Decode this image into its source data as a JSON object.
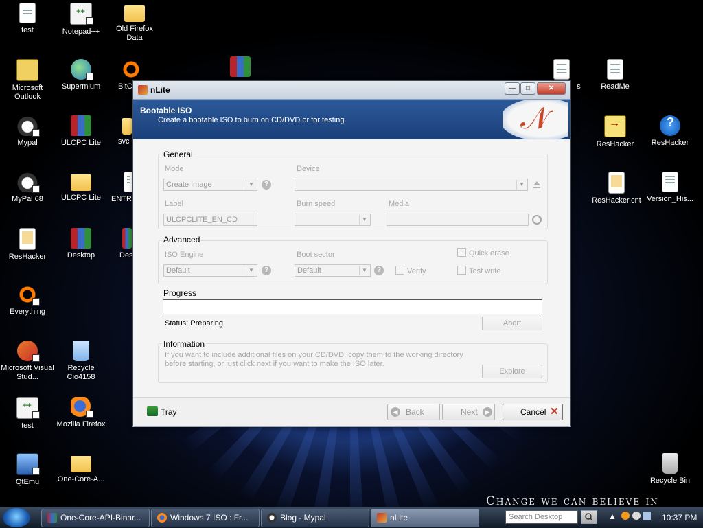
{
  "desktop": {
    "slogan": "Change we can believe in",
    "icons": [
      {
        "label": "test"
      },
      {
        "label": "Notepad++"
      },
      {
        "label": "Old Firefox Data"
      },
      {
        "label": "Microsoft Outlook"
      },
      {
        "label": "Supermium"
      },
      {
        "label": "BitC"
      },
      {
        "label": "s"
      },
      {
        "label": "ReadMe"
      },
      {
        "label": "Mypal"
      },
      {
        "label": "ULCPC Lite"
      },
      {
        "label": "svc"
      },
      {
        "label": "ResHacker"
      },
      {
        "label": "ResHacker"
      },
      {
        "label": "MyPal 68"
      },
      {
        "label": "ULCPC Lite"
      },
      {
        "label": "ENTRI"
      },
      {
        "label": "ResHacker.cnt"
      },
      {
        "label": "Version_His..."
      },
      {
        "label": "ResHacker"
      },
      {
        "label": "Desktop"
      },
      {
        "label": "Des"
      },
      {
        "label": "Everything"
      },
      {
        "label": "Microsoft Visual Stud..."
      },
      {
        "label": "Recycle Cio4158"
      },
      {
        "label": "test"
      },
      {
        "label": "Mozilla Firefox"
      },
      {
        "label": "QtEmu"
      },
      {
        "label": "One-Core-A..."
      },
      {
        "label": "Recycle Bin"
      }
    ]
  },
  "window": {
    "title": "nLite",
    "banner_title": "Bootable ISO",
    "banner_subtitle": "Create a bootable ISO to burn on CD/DVD or for testing.",
    "general": {
      "heading": "General",
      "mode_label": "Mode",
      "mode_value": "Create Image",
      "device_label": "Device",
      "device_value": "",
      "label_label": "Label",
      "label_value": "ULCPCLITE_EN_CD",
      "burn_speed_label": "Burn speed",
      "burn_speed_value": "",
      "media_label": "Media",
      "media_value": ""
    },
    "advanced": {
      "heading": "Advanced",
      "iso_engine_label": "ISO Engine",
      "iso_engine_value": "Default",
      "boot_sector_label": "Boot sector",
      "boot_sector_value": "Default",
      "verify_label": "Verify",
      "quick_erase_label": "Quick erase",
      "test_write_label": "Test write"
    },
    "progress": {
      "heading": "Progress",
      "status": "Status: Preparing",
      "abort_label": "Abort"
    },
    "information": {
      "heading": "Information",
      "text_line1": "If you want to include additional files on your CD/DVD, copy them to the working directory",
      "text_line2": "before starting, or just click next if you want to make the ISO later.",
      "explore_label": "Explore"
    },
    "footer": {
      "tray_label": "Tray",
      "back_label": "Back",
      "next_label": "Next",
      "cancel_label": "Cancel"
    }
  },
  "taskbar": {
    "tasks": [
      {
        "label": "One-Core-API-Binar..."
      },
      {
        "label": "Windows 7 ISO : Fr..."
      },
      {
        "label": "Blog - Mypal"
      },
      {
        "label": "nLite"
      }
    ],
    "search_placeholder": "Search Desktop",
    "clock": "10:37 PM"
  }
}
